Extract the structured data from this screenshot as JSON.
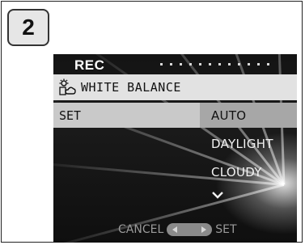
{
  "step": {
    "number": "2"
  },
  "menu": {
    "mode": "REC",
    "title": "WHITE BALANCE",
    "title_icon": "white-balance-icon",
    "set_label": "SET",
    "options": [
      {
        "label": "AUTO",
        "selected": true
      },
      {
        "label": "DAYLIGHT",
        "selected": false
      },
      {
        "label": "CLOUDY",
        "selected": false
      }
    ],
    "more_icon": "chevron-down-icon"
  },
  "footer": {
    "cancel_label": "CANCEL",
    "set_label": "SET"
  },
  "colors": {
    "title_bar": "#e2e2e2",
    "selected_option": "#a7a7a7",
    "set_row": "#c9c9c9",
    "screen_bg": "#141414"
  }
}
